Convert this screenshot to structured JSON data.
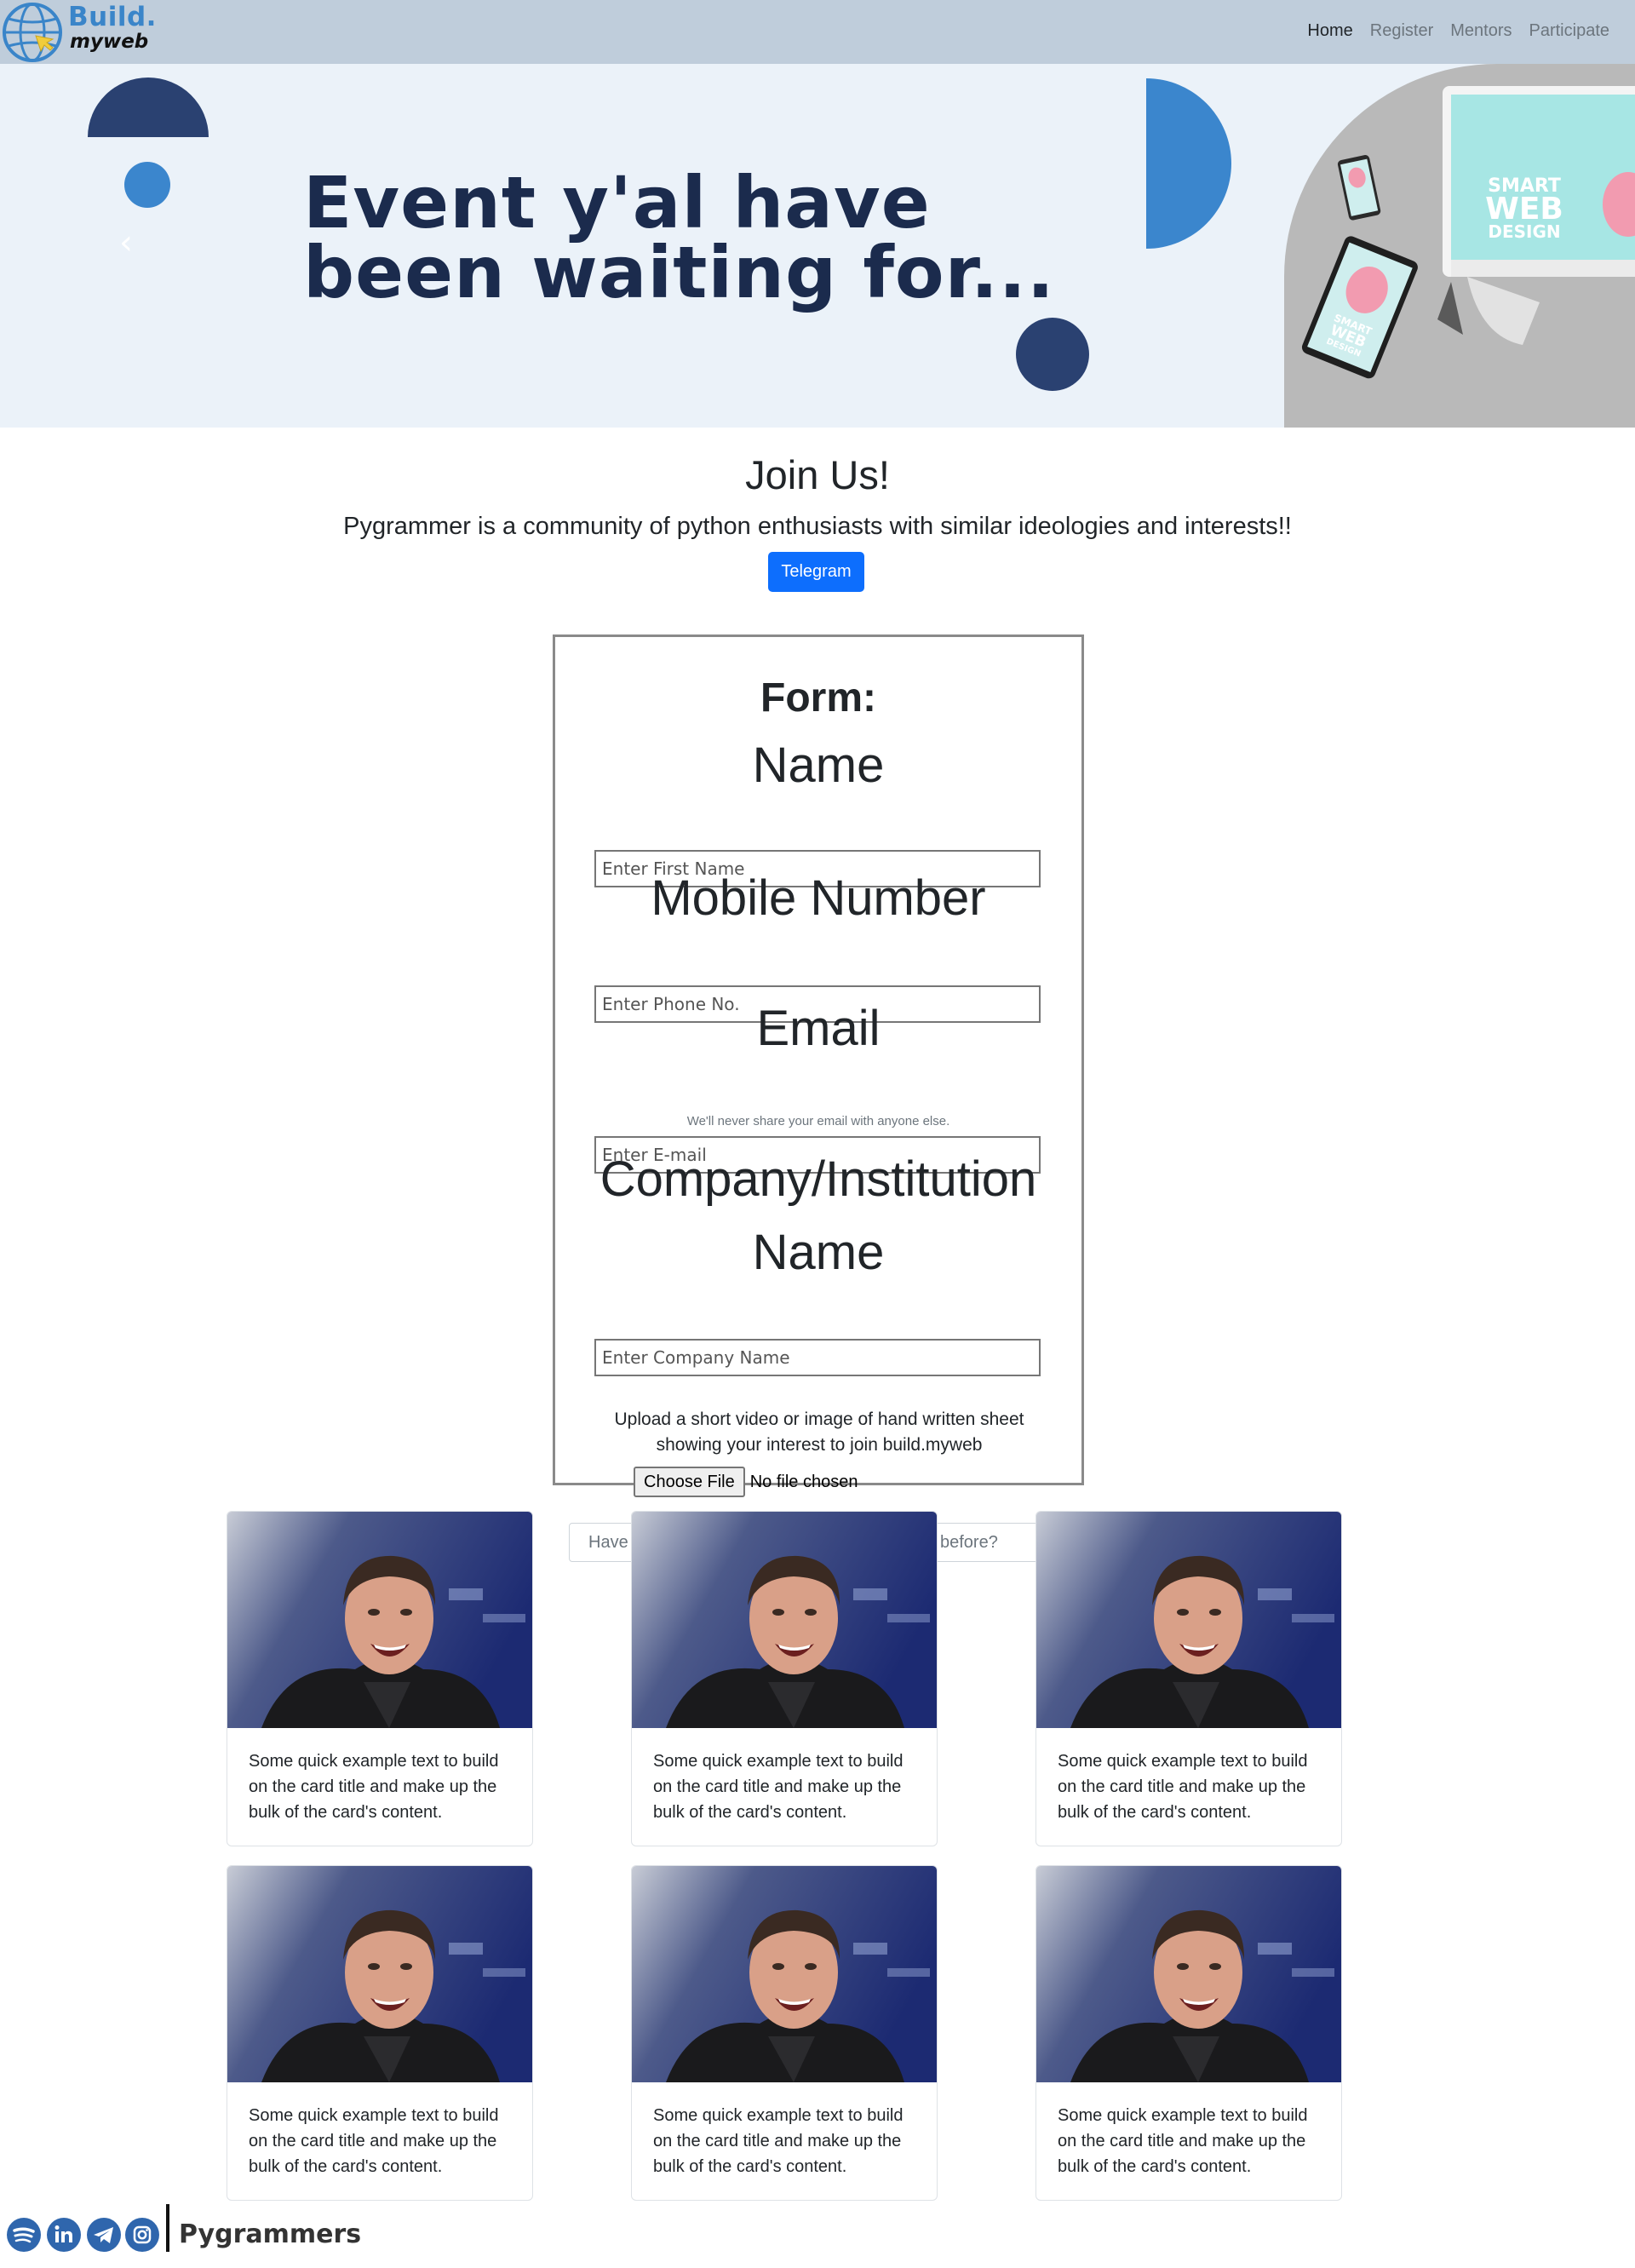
{
  "brand": {
    "line1": "Build.",
    "line2": "myweb"
  },
  "nav": {
    "items": [
      "Home",
      "Register",
      "Mentors",
      "Participate"
    ],
    "active": 0
  },
  "hero": {
    "title_line1": "Event y'al have",
    "title_line2": "been waiting for...",
    "prev_icon": "‹",
    "art": {
      "screen_line1": "SMART",
      "screen_line2": "WEB",
      "screen_line3": "DESIGN",
      "tablet_line1": "SMART",
      "tablet_line2": "WEB",
      "tablet_line3": "DESIGN"
    }
  },
  "join": {
    "title": "Join Us!",
    "subtitle": "Pygrammer is a community of python enthusiasts with similar ideologies and interests!!",
    "button": "Telegram"
  },
  "form": {
    "title": "Form:",
    "name_label": "Name",
    "name_placeholder": "Enter First Name",
    "mobile_label": "Mobile Number",
    "mobile_placeholder": "Enter Phone No.",
    "email_label": "Email",
    "email_help": "We'll never share your email with anyone else.",
    "email_placeholder": "Enter E-mail",
    "company_label_line1": "Company/Institution",
    "company_label_line2": "Name",
    "company_placeholder": "Enter Company Name",
    "upload_text": "Upload a short video or image of hand written sheet showing your interest to join build.myweb",
    "file_button": "Choose File",
    "file_status": "No file chosen",
    "question_left": "Have",
    "question_right": "before?"
  },
  "cards": [
    {
      "text": "Some quick example text to build on the card title and make up the bulk of the card's content."
    },
    {
      "text": "Some quick example text to build on the card title and make up the bulk of the card's content."
    },
    {
      "text": "Some quick example text to build on the card title and make up the bulk of the card's content."
    },
    {
      "text": "Some quick example text to build on the card title and make up the bulk of the card's content."
    },
    {
      "text": "Some quick example text to build on the card title and make up the bulk of the card's content."
    },
    {
      "text": "Some quick example text to build on the card title and make up the bulk of the card's content."
    }
  ],
  "footer": {
    "icons": [
      "spotify-icon",
      "linkedin-icon",
      "telegram-icon",
      "instagram-icon"
    ],
    "brand": "Pygrammers"
  },
  "colors": {
    "navbar": "#bfcddb",
    "hero_bg": "#ebf2f9",
    "hero_title": "#1b2b4d",
    "navy_shape": "#2a4171",
    "blue_shape": "#3b86cd",
    "button": "#0d6efd",
    "footer_icon": "#2f66ad"
  }
}
